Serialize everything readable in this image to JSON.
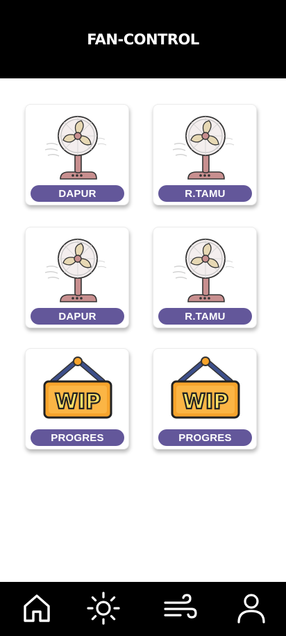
{
  "header": {
    "title": "FAN-CONTROL"
  },
  "cards": [
    {
      "label": "DAPUR",
      "icon": "fan-icon"
    },
    {
      "label": "R.TAMU",
      "icon": "fan-icon"
    },
    {
      "label": "DAPUR",
      "icon": "fan-icon"
    },
    {
      "label": "R.TAMU",
      "icon": "fan-icon"
    },
    {
      "label": "PROGRES",
      "icon": "wip-sign-icon"
    },
    {
      "label": "PROGRES",
      "icon": "wip-sign-icon"
    }
  ],
  "bottom_nav": {
    "items": [
      {
        "icon": "home-icon"
      },
      {
        "icon": "sun-icon"
      },
      {
        "icon": "wind-icon"
      },
      {
        "icon": "user-icon"
      }
    ]
  },
  "wip_text": "WIP",
  "colors": {
    "header_bg": "#000000",
    "label_bg": "#63579a",
    "label_text": "#ffffff",
    "wip_sign": "#f7a42c",
    "fan_body": "#c88f8f"
  }
}
